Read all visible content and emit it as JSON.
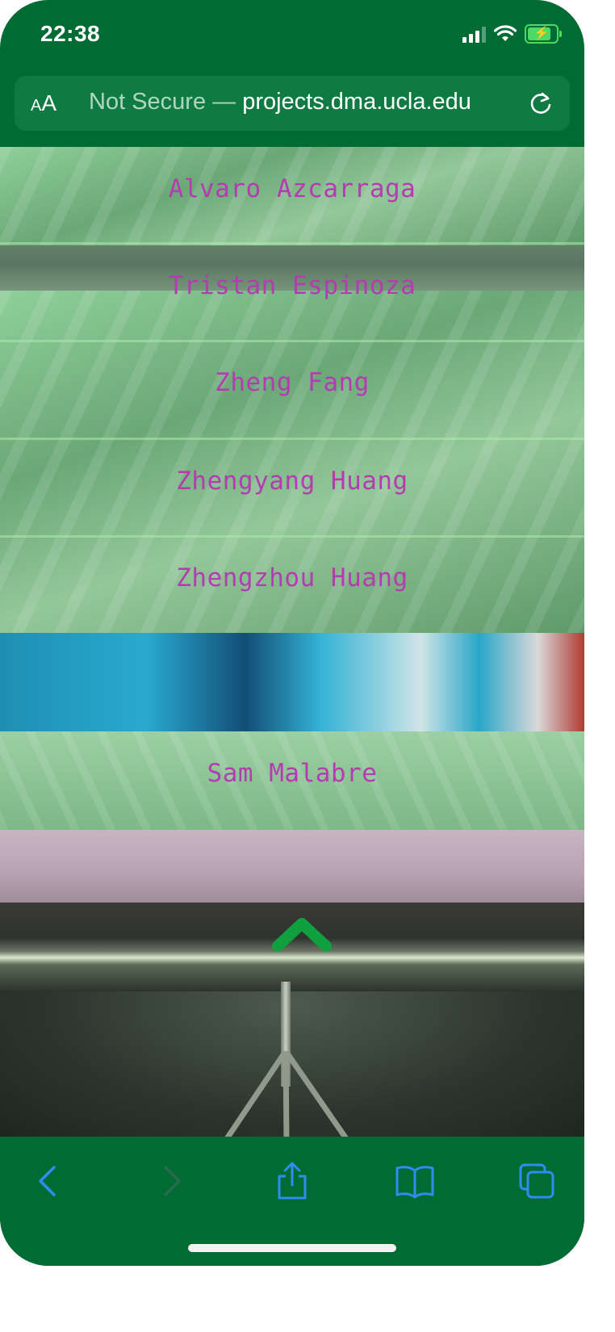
{
  "status_bar": {
    "time": "22:38",
    "icons": [
      "cellular-signal-icon",
      "wifi-icon",
      "battery-charging-icon"
    ],
    "battery_color": "#4cd964"
  },
  "address_bar": {
    "text_size_button": "AA",
    "security_label": "Not Secure — ",
    "domain": "projects.dma.ucla.edu",
    "reload_icon": "reload-icon"
  },
  "students": [
    "Alvaro Azcarraga",
    "Tristan Espinoza",
    "Zheng Fang",
    "Zhengyang Huang",
    "Zhengzhou Huang",
    "Sam Malabre"
  ],
  "scroll_to_top_icon": "chevron-up-icon",
  "toolbar": {
    "icons": [
      "back-icon",
      "forward-icon",
      "share-icon",
      "bookmarks-icon",
      "tabs-icon"
    ]
  },
  "colors": {
    "browser_chrome": "#006b33",
    "name_text": "#b43cb0",
    "accent_arrow": "#10a040",
    "toolbar_icon": "#2f8cf0"
  }
}
